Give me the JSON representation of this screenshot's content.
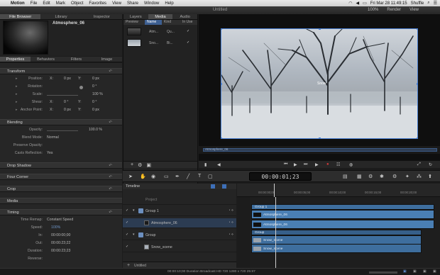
{
  "menubar": {
    "apple": "",
    "app": "Motion",
    "items": [
      "File",
      "Edit",
      "Mark",
      "Object",
      "Favorites",
      "View",
      "Share",
      "Window",
      "Help"
    ],
    "clock": "Fri Mar 28  11:49:15",
    "user": "Shuffle"
  },
  "window": {
    "title": "Untitled",
    "zoom": "100%",
    "render": "Render",
    "view": "View"
  },
  "library_tabs": [
    {
      "label": "File Browser",
      "active": true
    },
    {
      "label": "Library",
      "active": false
    },
    {
      "label": "Inspector",
      "active": false
    }
  ],
  "preview": {
    "title": "Atmosphere_06"
  },
  "inspector_tabs": [
    {
      "label": "Properties",
      "active": true
    },
    {
      "label": "Behaviors",
      "active": false
    },
    {
      "label": "Filters",
      "active": false
    },
    {
      "label": "Image",
      "active": false
    }
  ],
  "inspector": {
    "transform": {
      "heading": "Transform",
      "position": {
        "label": "Position:",
        "x_label": "X:",
        "x": "0 px",
        "y_label": "Y:",
        "y": "0 px"
      },
      "rotation": {
        "label": "Rotation:",
        "value": "0 °"
      },
      "scale": {
        "label": "Scale:",
        "value": "100 %"
      },
      "shear": {
        "label": "Shear:",
        "x_label": "X:",
        "x": "0 °",
        "y_label": "Y:",
        "y": "0 °"
      },
      "anchor": {
        "label": "Anchor Point:",
        "x_label": "X:",
        "x": "0 px",
        "y_label": "Y:",
        "y": "0 px"
      }
    },
    "blending": {
      "heading": "Blending",
      "opacity": {
        "label": "Opacity:",
        "value": "100.0 %"
      },
      "blend_mode": {
        "label": "Blend Mode:",
        "value": "Normal"
      },
      "preserve_opacity": {
        "label": "Preserve Opacity:"
      },
      "casts_reflection": {
        "label": "Casts Reflection:",
        "value": "Yes"
      }
    },
    "sections": [
      "Drop Shadow",
      "Four Corner",
      "Crop",
      "Media"
    ],
    "timing": {
      "heading": "Timing",
      "time_remap": {
        "label": "Time Remap:",
        "value": "Constant Speed"
      },
      "speed": {
        "label": "Speed:",
        "value": "100%"
      },
      "in": {
        "label": "In:",
        "value": "00:00:00;00"
      },
      "out": {
        "label": "Out:",
        "value": "00:00:23;22"
      },
      "duration": {
        "label": "Duration:",
        "value": "00:00:23;23"
      },
      "reverse": {
        "label": "Reverse:"
      }
    }
  },
  "browser": {
    "tabs": [
      {
        "label": "Layers",
        "active": false
      },
      {
        "label": "Media",
        "active": true
      },
      {
        "label": "Audio",
        "active": false
      }
    ],
    "columns": [
      "Preview",
      "Name",
      "Kind",
      "In Use"
    ],
    "rows": [
      {
        "name": "Atm...",
        "kind": "Qu...",
        "in_use": "✓"
      },
      {
        "name": "Sno...",
        "kind": "Bi...",
        "in_use": "✓"
      }
    ]
  },
  "canvas": {
    "object_label": "Snow",
    "scrub_label": "Atmosphere_06"
  },
  "timecode": "00:00:01;23",
  "timeline": {
    "heading": "Timeline",
    "ruler": [
      "00:00:00;00",
      "00:00:05;00",
      "00:00:10;00",
      "00:00:15;00",
      "00:00:20;00"
    ],
    "layers": [
      {
        "name": "Project",
        "indent": 0
      },
      {
        "name": "Group 1",
        "indent": 1
      },
      {
        "name": "Atmosphere_06",
        "indent": 2
      },
      {
        "name": "Group",
        "indent": 1
      },
      {
        "name": "Snow_scene",
        "indent": 2
      }
    ],
    "clips": {
      "group1": "Group 1",
      "atm1": "Atmosphere_06",
      "atm2": "Atmosphere_06",
      "group": "Group",
      "snow1": "Snow_scene",
      "snow2": "Snow_scene"
    },
    "footer": "Untitled"
  },
  "status": {
    "text": "00:00:10;00  Duration  Broadcast HD 720  1280 x 720  29.97"
  },
  "colors": {
    "accent": "#4a7fd1",
    "clip": "#3e6e9e",
    "record": "#d43a3a"
  }
}
